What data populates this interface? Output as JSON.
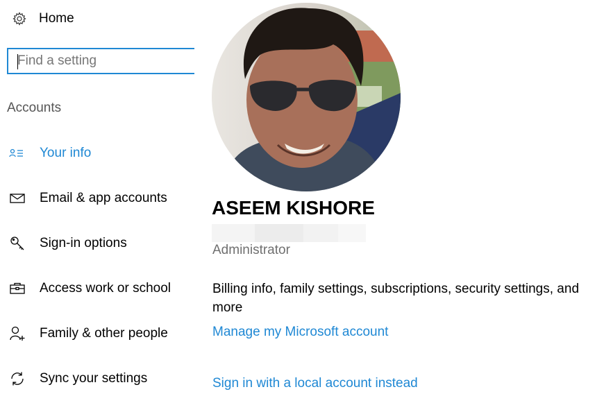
{
  "sidebar": {
    "home_label": "Home",
    "search": {
      "placeholder": "Find a setting",
      "value": ""
    },
    "section_title": "Accounts",
    "items": [
      {
        "label": "Your info",
        "icon": "person-card-icon",
        "active": true
      },
      {
        "label": "Email & app accounts",
        "icon": "mail-icon"
      },
      {
        "label": "Sign-in options",
        "icon": "key-icon"
      },
      {
        "label": "Access work or school",
        "icon": "briefcase-icon"
      },
      {
        "label": "Family & other people",
        "icon": "person-add-icon"
      },
      {
        "label": "Sync your settings",
        "icon": "sync-icon"
      }
    ]
  },
  "profile": {
    "name": "ASEEM KISHORE",
    "role": "Administrator",
    "description": "Billing info, family settings, subscriptions, security settings, and more",
    "manage_link": "Manage my Microsoft account",
    "local_account_link": "Sign in with a local account instead"
  },
  "colors": {
    "accent": "#1f88d4",
    "text": "#000000",
    "muted": "#6f6f6f"
  }
}
